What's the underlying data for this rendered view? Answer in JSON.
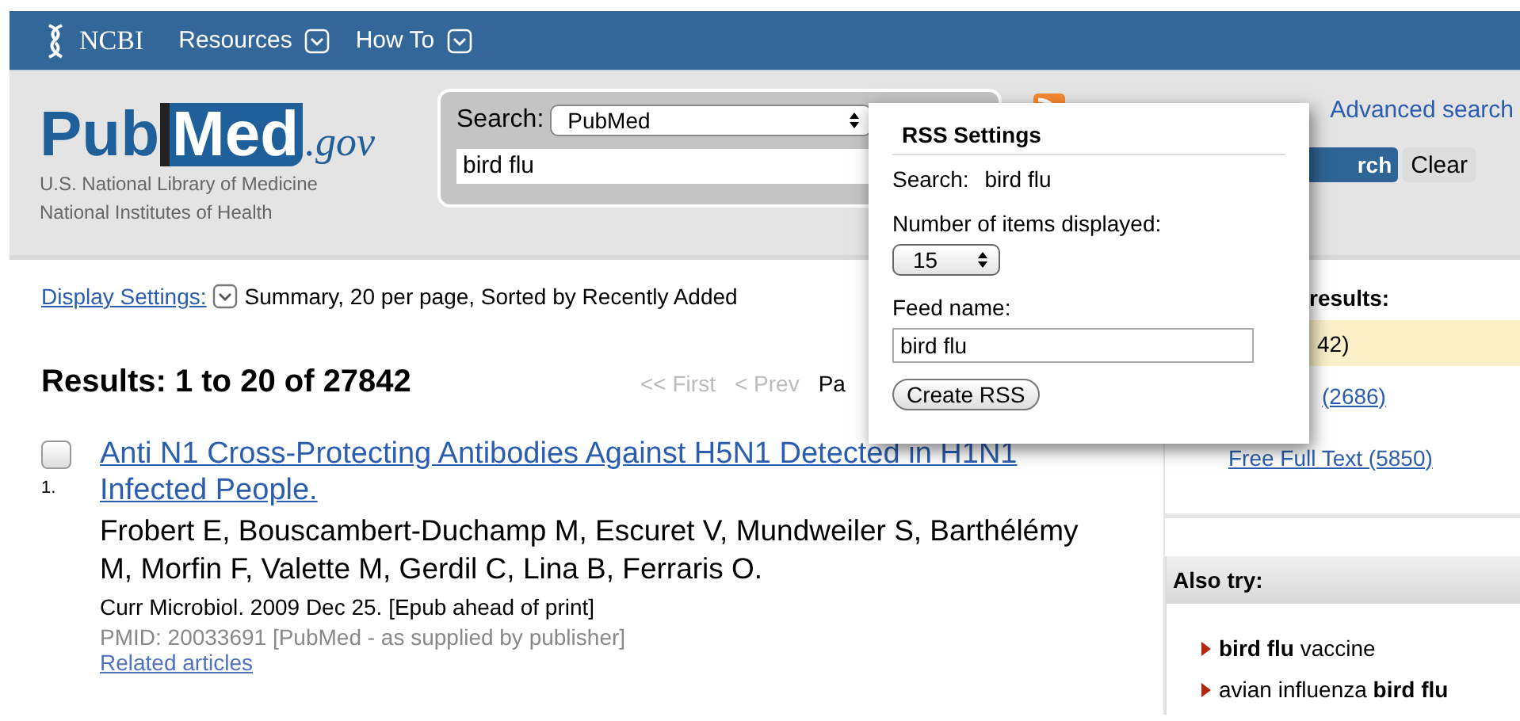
{
  "top_nav": {
    "brand": "NCBI",
    "menus": [
      {
        "label": "Resources"
      },
      {
        "label": "How To"
      }
    ]
  },
  "logo": {
    "part_1": "Pub",
    "part_2": "Med",
    "suffix": ".gov",
    "lines": [
      "U.S. National Library of Medicine",
      "National Institutes of Health"
    ]
  },
  "search": {
    "label": "Search:",
    "database": "PubMed",
    "query": "bird flu"
  },
  "advanced_search": "Advanced search",
  "search_button_visible": "rch",
  "clear_button": "Clear",
  "display_settings": {
    "link": "Display Settings:",
    "summary": "Summary, 20 per page, Sorted by Recently Added"
  },
  "results_heading": "Results: 1 to 20 of 27842",
  "pager": [
    {
      "label": "<< First",
      "disabled": true
    },
    {
      "label": "< Prev",
      "disabled": true
    },
    {
      "label": "Pa",
      "disabled": false
    }
  ],
  "results": [
    {
      "number": "1.",
      "checked": false,
      "title": "Anti N1 Cross-Protecting Antibodies Against H5N1 Detected in H1N1 Infected People.",
      "authors": "Frobert E, Bouscambert-Duchamp M, Escuret V, Mundweiler S, Barthélémy M, Morfin F, Valette M, Gerdil C, Lina B, Ferraris O.",
      "journal": "Curr Microbiol. 2009 Dec 25. [Epub ahead of print]",
      "pmid": "PMID: 20033691 [PubMed - as supplied by publisher]",
      "related": "Related articles"
    }
  ],
  "filter": {
    "heading_visible": "results:",
    "items": [
      {
        "label": "42)",
        "selected": true
      },
      {
        "label": "(2686)",
        "selected": false
      },
      {
        "label": "Free Full Text (5850)",
        "selected": false
      }
    ]
  },
  "also_try": {
    "heading": "Also try:",
    "items": [
      "**bird flu** vaccine",
      "avian influenza **bird flu**"
    ]
  },
  "rss_popup": {
    "title": "RSS Settings",
    "search_label": "Search:",
    "search_value": "bird flu",
    "items_label": "Number of items displayed:",
    "items_value": "15",
    "feed_label": "Feed name:",
    "feed_value": "bird flu",
    "button": "Create RSS"
  }
}
